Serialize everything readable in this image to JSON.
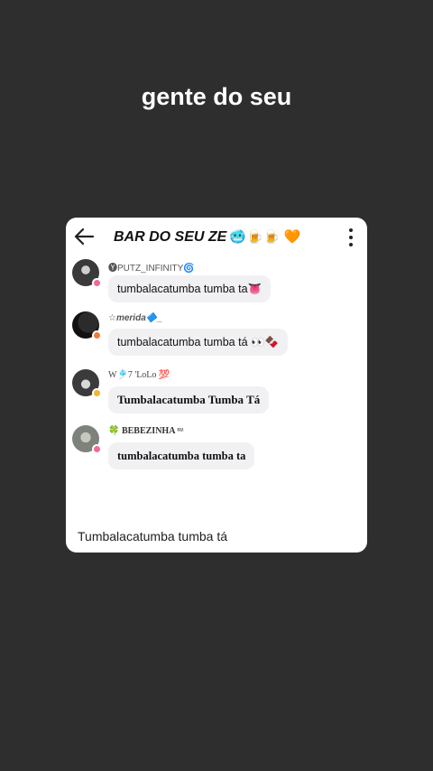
{
  "caption": "gente do seu",
  "chat": {
    "title": "BAR DO SEU ZE",
    "title_emojis": "🥶🍺🍺 🧡",
    "messages": [
      {
        "username": "🅨PUTZ_INFINITY🌀",
        "text": "tumbalacatumba tumba ta👅",
        "avatar_color": "#3a3a3a",
        "badge_color": "#f06a9a"
      },
      {
        "username": "☆merida🔷_",
        "text": "tumbalacatumba tumba tá 👀🍫",
        "avatar_color": "#1f1f1f",
        "badge_color": "#f07a3a"
      },
      {
        "username": "W🎐7 'LoLo 💯",
        "text": "Tumbalacatumba Tumba Tá",
        "avatar_color": "#4a4a4a",
        "badge_color": "#f2b632"
      },
      {
        "username": "🍀 BEBEZINHA ᵗᵗᶻ",
        "text": "tumbalacatumba tumba ta",
        "avatar_color": "#8a8f86",
        "badge_color": "#f06a9a"
      }
    ],
    "input_value": "Tumbalacatumba tumba tá"
  },
  "icons": [
    "back-arrow-icon",
    "more-vertical-icon"
  ]
}
